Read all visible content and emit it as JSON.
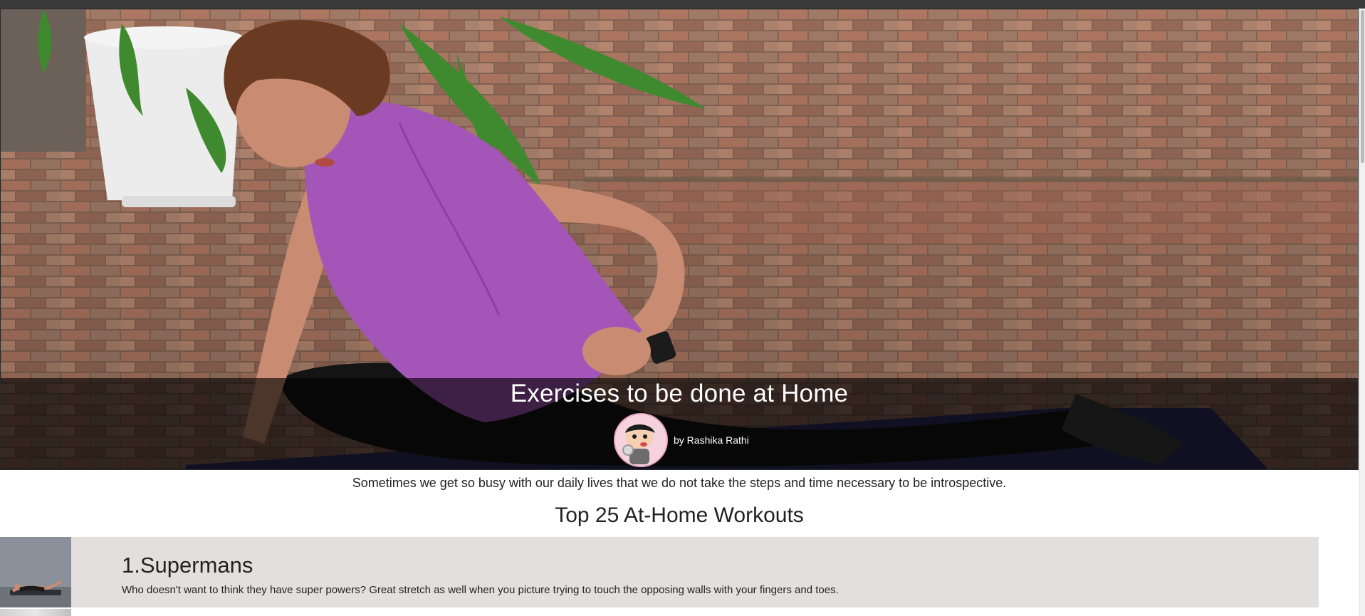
{
  "hero": {
    "title": "Exercises to be done at Home",
    "author": "by Rashika Rathi"
  },
  "intro_text": "Sometimes we get so busy with our daily lives that we do not take the steps and time necessary to be introspective.",
  "section_title": "Top 25 At-Home Workouts",
  "workouts": [
    {
      "title": "1.Supermans",
      "description": "Who doesn't want to think they have super powers?  Great stretch as well when you picture trying to touch the opposing walls with your fingers and toes."
    }
  ],
  "colors": {
    "card_background": "#e3dfdf",
    "overlay": "rgba(0,0,0,0.62)",
    "shirt": "#a356b8"
  }
}
